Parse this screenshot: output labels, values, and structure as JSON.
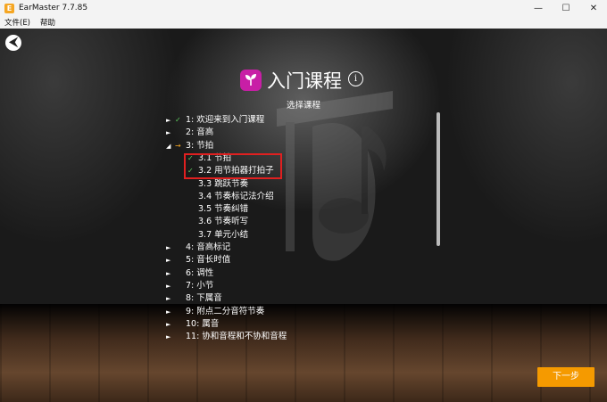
{
  "window": {
    "title": "EarMaster 7.7.85",
    "icon_letter": "E"
  },
  "window_controls": {
    "minimize": "—",
    "maximize": "☐",
    "close": "✕"
  },
  "menu": [
    "文件(E)",
    "帮助"
  ],
  "page": {
    "title": "入门课程",
    "subtitle": "选择课程",
    "info_symbol": "i"
  },
  "lessons": [
    {
      "arrow": "►",
      "status": "✓",
      "label": "1: 欢迎来到入门课程"
    },
    {
      "arrow": "►",
      "status": "",
      "label": "2: 音高"
    },
    {
      "arrow": "◢",
      "status": "→",
      "label": "3: 节拍"
    },
    {
      "arrow": "",
      "status": "✓",
      "label": "3.1 节拍"
    },
    {
      "arrow": "",
      "status": "✓",
      "label": "3.2 用节拍器打拍子"
    },
    {
      "arrow": "",
      "status": "",
      "label": "3.3 跳跃节奏"
    },
    {
      "arrow": "",
      "status": "",
      "label": "3.4 节奏标记法介绍"
    },
    {
      "arrow": "",
      "status": "",
      "label": "3.5 节奏纠错"
    },
    {
      "arrow": "",
      "status": "",
      "label": "3.6 节奏听写"
    },
    {
      "arrow": "",
      "status": "",
      "label": "3.7 单元小结"
    },
    {
      "arrow": "►",
      "status": "",
      "label": "4: 音高标记"
    },
    {
      "arrow": "►",
      "status": "",
      "label": "5: 音长时值"
    },
    {
      "arrow": "►",
      "status": "",
      "label": "6: 调性"
    },
    {
      "arrow": "►",
      "status": "",
      "label": "7: 小节"
    },
    {
      "arrow": "►",
      "status": "",
      "label": "8: 下属音"
    },
    {
      "arrow": "►",
      "status": "",
      "label": "9: 附点二分音符节奏"
    },
    {
      "arrow": "►",
      "status": "",
      "label": "10: 属音"
    },
    {
      "arrow": "►",
      "status": "",
      "label": "11: 协和音程和不协和音程"
    }
  ],
  "buttons": {
    "back_symbol": "⮜",
    "next": "下一步"
  },
  "colors": {
    "accent": "#f59a00",
    "brand": "#c81fa6",
    "check": "#5fcf5f",
    "highlight": "#e02020"
  }
}
